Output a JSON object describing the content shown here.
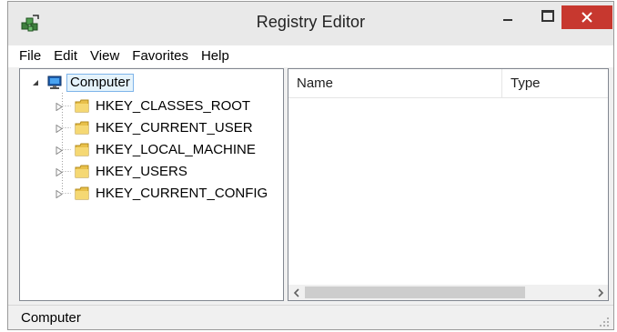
{
  "window": {
    "title": "Registry Editor",
    "close_color": "#c7382f"
  },
  "menu": {
    "items": [
      {
        "label": "File"
      },
      {
        "label": "Edit"
      },
      {
        "label": "View"
      },
      {
        "label": "Favorites"
      },
      {
        "label": "Help"
      }
    ]
  },
  "tree": {
    "root": {
      "label": "Computer",
      "icon": "computer-icon",
      "expanded": true,
      "selected": true
    },
    "children": [
      {
        "label": "HKEY_CLASSES_ROOT",
        "icon": "folder-icon"
      },
      {
        "label": "HKEY_CURRENT_USER",
        "icon": "folder-icon"
      },
      {
        "label": "HKEY_LOCAL_MACHINE",
        "icon": "folder-icon"
      },
      {
        "label": "HKEY_USERS",
        "icon": "folder-icon"
      },
      {
        "label": "HKEY_CURRENT_CONFIG",
        "icon": "folder-icon"
      }
    ]
  },
  "list": {
    "columns": [
      {
        "label": "Name"
      },
      {
        "label": "Type"
      }
    ]
  },
  "status": {
    "text": "Computer"
  }
}
